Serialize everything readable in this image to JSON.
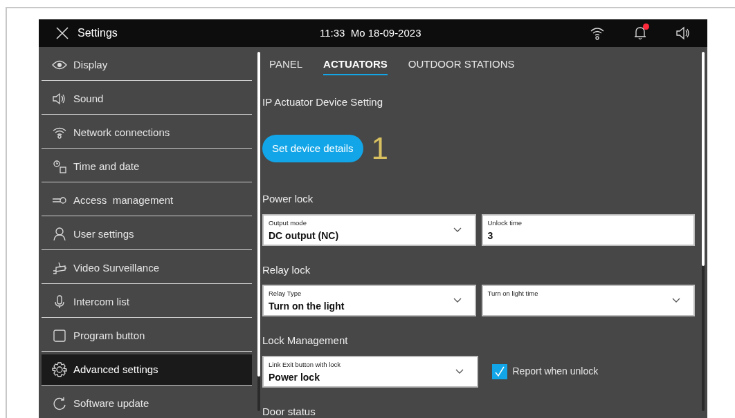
{
  "header": {
    "title": "Settings",
    "datetime": "11:33  Mo 18-09-2023",
    "notification_unread": true
  },
  "sidebar": {
    "items": [
      {
        "label": "Display",
        "selected": false
      },
      {
        "label": "Sound",
        "selected": false
      },
      {
        "label": "Network connections",
        "selected": false
      },
      {
        "label": "Time and date",
        "selected": false
      },
      {
        "label": "Access  management",
        "selected": false
      },
      {
        "label": "User settings",
        "selected": false
      },
      {
        "label": "Video Surveillance",
        "selected": false
      },
      {
        "label": "Intercom list",
        "selected": false
      },
      {
        "label": "Program button",
        "selected": false
      },
      {
        "label": "Advanced settings",
        "selected": true
      },
      {
        "label": "Software update",
        "selected": false
      }
    ]
  },
  "tabs": [
    {
      "label": "PANEL",
      "selected": false
    },
    {
      "label": "ACTUATORS",
      "selected": true
    },
    {
      "label": "OUTDOOR STATIONS",
      "selected": false
    }
  ],
  "content": {
    "title": "IP Actuator Device Setting",
    "button": "Set device details",
    "marker": "1",
    "sections": [
      {
        "heading": "Power lock",
        "items": [
          {
            "kind": "dropdown",
            "label": "Output mode",
            "value": "DC output (NC)"
          },
          {
            "kind": "text",
            "label": "Unlock time",
            "value": "3"
          }
        ]
      },
      {
        "heading": "Relay lock",
        "items": [
          {
            "kind": "dropdown",
            "label": "Relay Type",
            "value": "Turn on the light"
          },
          {
            "kind": "dropdown",
            "label": "Turn on light time"
          }
        ]
      },
      {
        "heading": "Lock Management",
        "items": [
          {
            "kind": "dropdown",
            "label": "Link Exit button with lock",
            "value": "Power lock"
          },
          {
            "kind": "checkbox",
            "label": "Report when unlock",
            "checked": true
          }
        ]
      },
      {
        "heading": "Door status"
      }
    ]
  }
}
